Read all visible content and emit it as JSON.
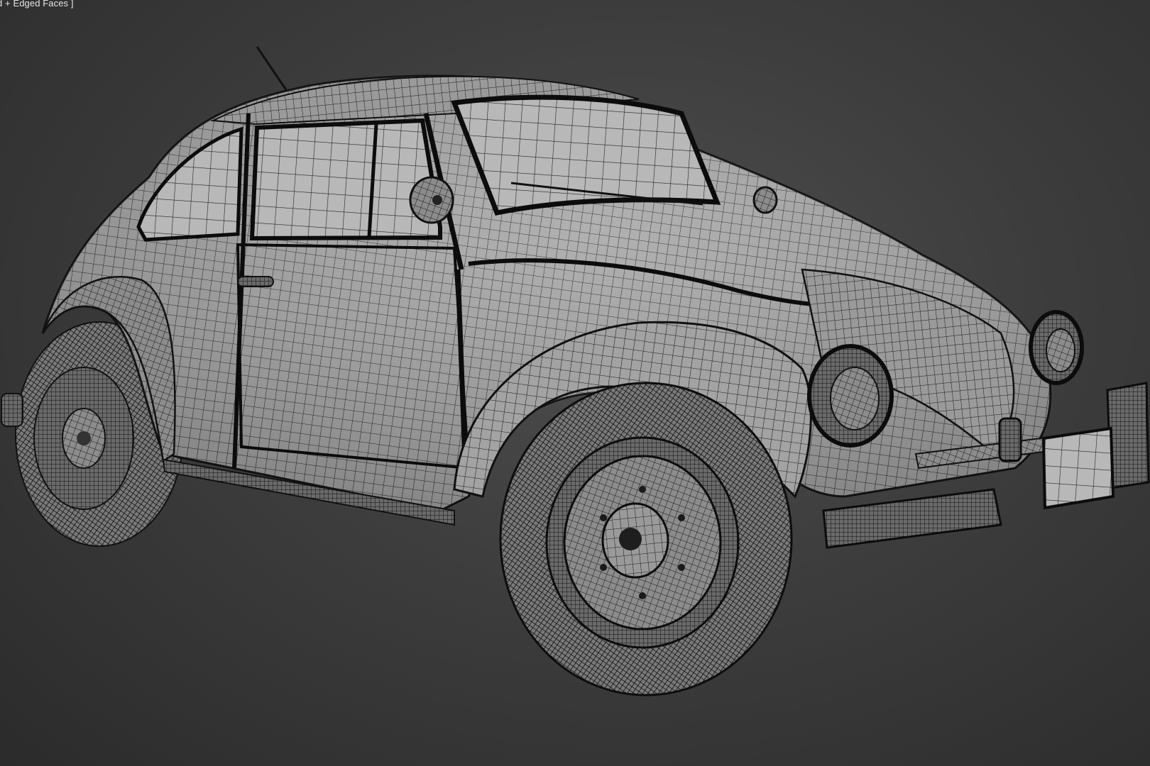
{
  "viewport": {
    "label": "d + Edged Faces ]",
    "shading_mode": "Edged Faces",
    "background_color": "#3d3d3d",
    "mesh_fill_color": "#9b9b9b",
    "mesh_wire_color": "#1a1a1a"
  },
  "scene": {
    "model": "wireframe-car",
    "parts": [
      "body",
      "roof",
      "windshield",
      "side-windows",
      "rear-window",
      "door",
      "front-hood",
      "front-fender",
      "rear-fender",
      "front-wheel",
      "rear-wheel",
      "headlights",
      "bumper",
      "license-plate",
      "side-mirror",
      "wiper",
      "antenna",
      "door-handle",
      "running-board"
    ]
  }
}
